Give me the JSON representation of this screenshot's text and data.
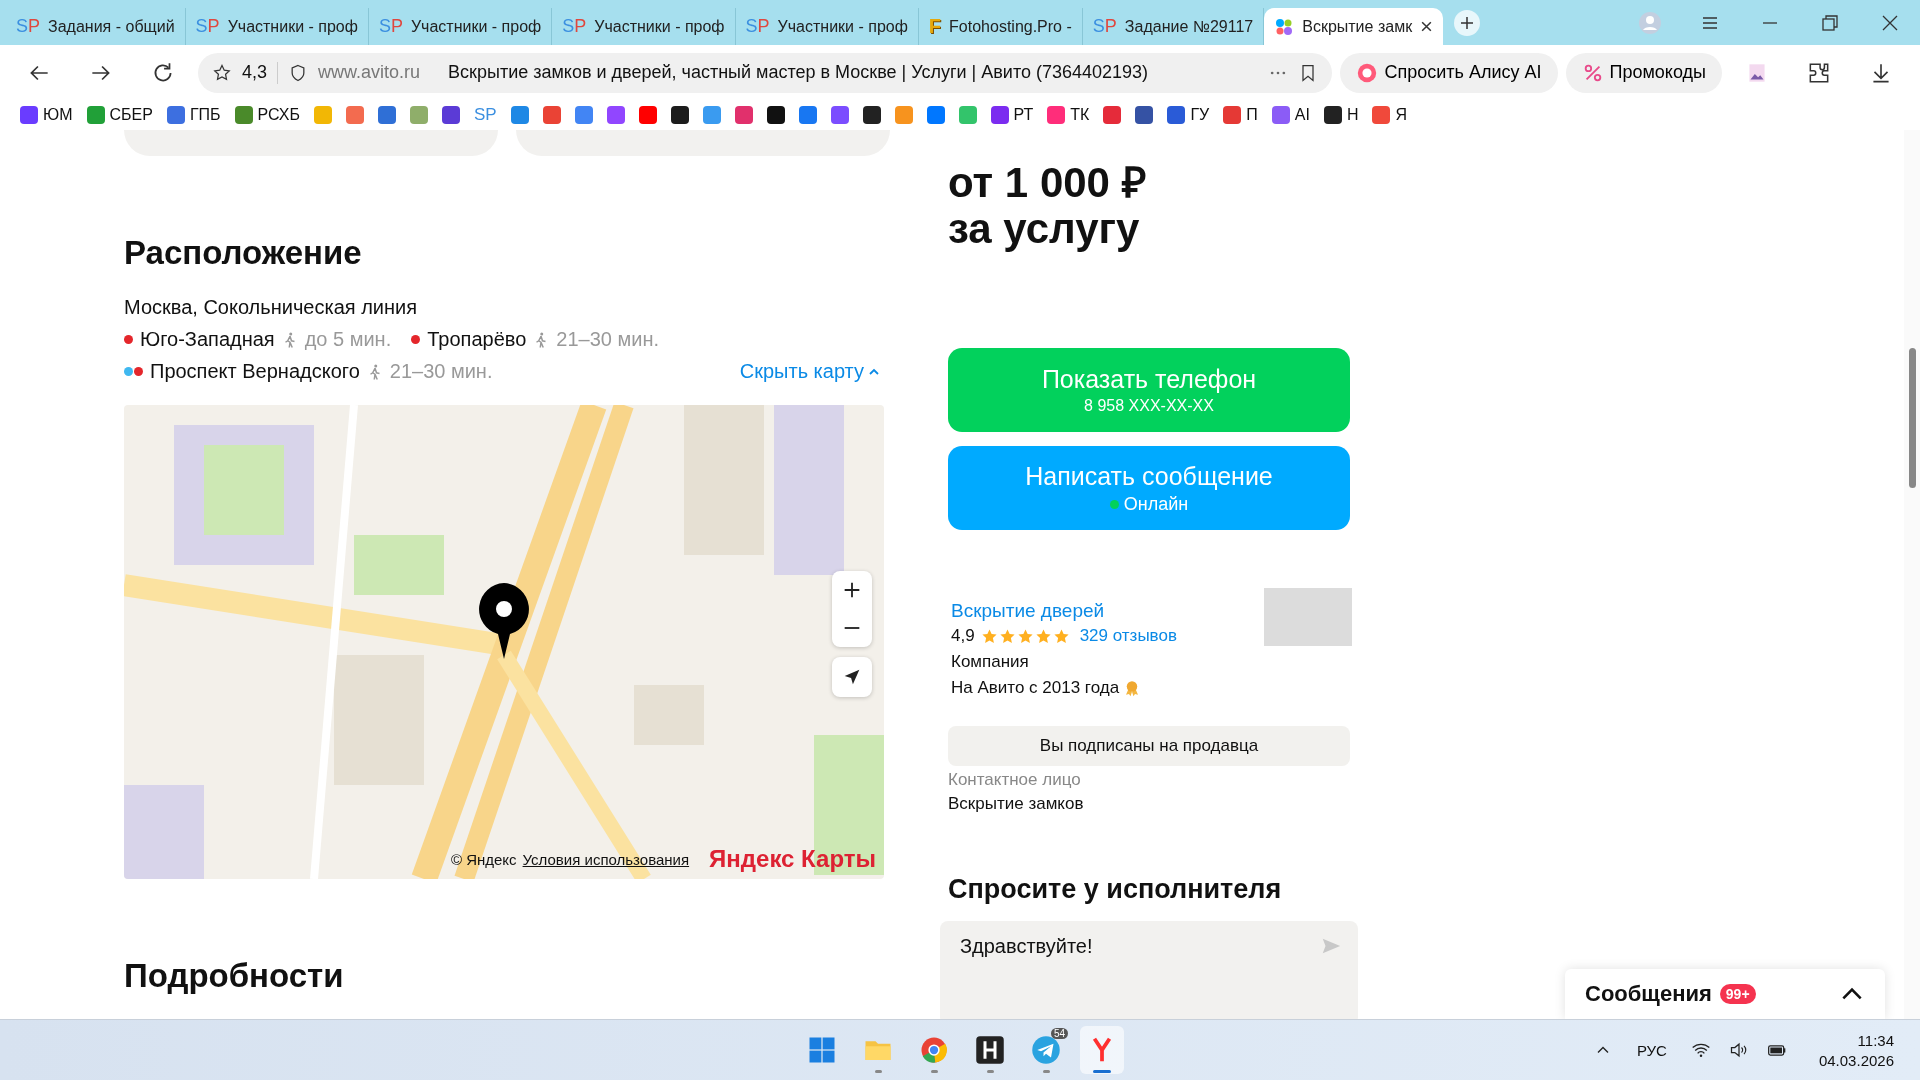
{
  "browser": {
    "tabs": [
      {
        "favicon": "SP",
        "label": "Задания - общий",
        "selected": false
      },
      {
        "favicon": "SP",
        "label": "Участники - проф",
        "selected": false
      },
      {
        "favicon": "SP",
        "label": "Участники - проф",
        "selected": false
      },
      {
        "favicon": "SP",
        "label": "Участники - проф",
        "selected": false
      },
      {
        "favicon": "SP",
        "label": "Участники - проф",
        "selected": false
      },
      {
        "favicon": "F",
        "label": "Fotohosting.Pro -",
        "selected": false
      },
      {
        "favicon": "SP",
        "label": "Задание №29117",
        "selected": false
      },
      {
        "label": "Вскрытие замк",
        "selected": true
      }
    ],
    "rating": "4,3",
    "domain": "www.avito.ru",
    "page_title": "Вскрытие замков и дверей, частный мастер в Москве | Услуги | Авито (7364402193)",
    "alice_button": "Спросить Алису AI",
    "promo_button": "Промокоды"
  },
  "bookmarks": [
    {
      "kind": "icon",
      "color": "#6a3cff",
      "label": "ЮМ"
    },
    {
      "kind": "icon",
      "color": "#21a038",
      "label": "СБЕР"
    },
    {
      "kind": "icon",
      "color": "#3d6fe0",
      "label": "ГПБ"
    },
    {
      "kind": "icon",
      "color": "#4a8a2a",
      "label": "РСХБ"
    },
    {
      "kind": "icon",
      "color": "#f2b705"
    },
    {
      "kind": "icon",
      "color": "#f36b4f"
    },
    {
      "kind": "icon",
      "color": "#2f6fd6"
    },
    {
      "kind": "icon",
      "color": "#8fae6a"
    },
    {
      "kind": "icon",
      "color": "#5b3bd6"
    },
    {
      "kind": "text",
      "label": "SP"
    },
    {
      "kind": "icon",
      "color": "#1e88e5"
    },
    {
      "kind": "icon",
      "color": "#ea4335"
    },
    {
      "kind": "icon",
      "color": "#4285f4"
    },
    {
      "kind": "icon",
      "color": "#9146ff"
    },
    {
      "kind": "icon",
      "color": "#ff0000"
    },
    {
      "kind": "icon",
      "color": "#1c1c1c"
    },
    {
      "kind": "icon",
      "color": "#3a9bf0"
    },
    {
      "kind": "icon",
      "color": "#e1306c"
    },
    {
      "kind": "icon",
      "color": "#111111"
    },
    {
      "kind": "icon",
      "color": "#1877f2"
    },
    {
      "kind": "icon",
      "color": "#7b4dff"
    },
    {
      "kind": "icon",
      "color": "#222222"
    },
    {
      "kind": "icon",
      "color": "#f7931e"
    },
    {
      "kind": "icon",
      "color": "#0077ff"
    },
    {
      "kind": "icon",
      "color": "#33c46b"
    },
    {
      "kind": "icon",
      "color": "#7b2cf0",
      "label": "РТ"
    },
    {
      "kind": "icon",
      "color": "#ff2d7a",
      "label": "ТК"
    },
    {
      "kind": "icon",
      "color": "#e52b3a"
    },
    {
      "kind": "icon",
      "color": "#3552a4"
    },
    {
      "kind": "icon",
      "color": "#2a5bd7",
      "label": "ГУ"
    },
    {
      "kind": "icon",
      "color": "#e53935",
      "label": "П"
    },
    {
      "kind": "icon",
      "color": "#8b5cf6",
      "label": "AI"
    },
    {
      "kind": "icon",
      "color": "#222222",
      "label": "Н"
    },
    {
      "kind": "icon",
      "color": "#f0493b",
      "label": "Я"
    }
  ],
  "location": {
    "heading": "Расположение",
    "address": "Москва, Сокольническая линия",
    "stations": [
      {
        "name": "Юго-Западная",
        "lines": [
          {
            "color": "#e4262b"
          }
        ],
        "time": "до 5 мин."
      },
      {
        "name": "Тропарёво",
        "lines": [
          {
            "color": "#e4262b"
          }
        ],
        "time": "21–30 мин."
      },
      {
        "name": "Проспект Вернадского",
        "lines": [
          {
            "color": "#3fb8f0"
          },
          {
            "color": "#e4262b"
          }
        ],
        "time": "21–30 мин."
      }
    ],
    "hide_map_link": "Скрыть карту",
    "map": {
      "copyright": "© Яндекс",
      "terms_link": "Условия использования",
      "logo": "Яндекс Карты"
    }
  },
  "details_heading": "Подробности",
  "offer": {
    "price": "от 1 000 ₽",
    "price_unit": "за услугу",
    "phone_button": {
      "label": "Показать телефон",
      "number": "8 958 XXX-XX-XX"
    },
    "message_button": {
      "label": "Написать сообщение",
      "status": "Онлайн",
      "online": true
    },
    "seller": {
      "name": "Вскрытие дверей",
      "rating": "4,9",
      "stars": 5,
      "reviews": "329 отзывов",
      "type": "Компания",
      "since": "На Авито с 2013 года"
    },
    "subscribed_button": "Вы подписаны на продавца",
    "contact_label": "Контактное лицо",
    "contact_name": "Вскрытие замков",
    "ask_heading": "Спросите у исполнителя",
    "ask_message": "Здравствуйте!"
  },
  "messages_panel": {
    "title": "Сообщения",
    "badge": "99+"
  },
  "taskbar": {
    "apps": [
      {
        "kind": "windows",
        "active": false,
        "selected": false
      },
      {
        "kind": "folder",
        "active": true,
        "selected": false
      },
      {
        "kind": "chrome",
        "active": true,
        "selected": false
      },
      {
        "kind": "h",
        "active": true,
        "selected": false
      },
      {
        "kind": "telegram",
        "active": true,
        "selected": false,
        "badge": "54"
      },
      {
        "kind": "yandex",
        "active": true,
        "selected": true
      }
    ],
    "language": "РУС",
    "time": "11:34",
    "date": "04.03.2026"
  }
}
